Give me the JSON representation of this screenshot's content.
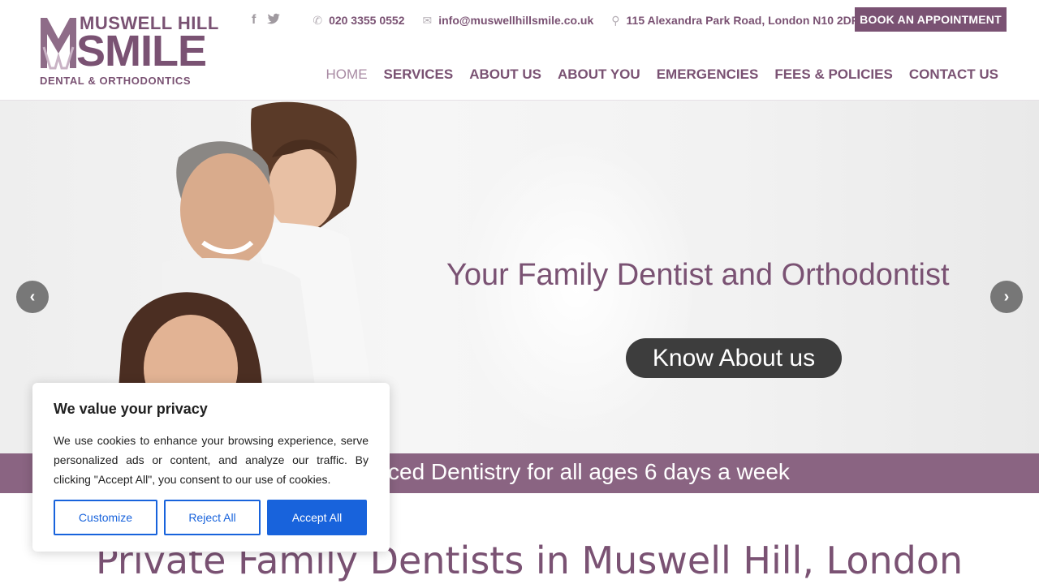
{
  "logo": {
    "line1": "MUSWELL HILL",
    "line2": "SMILE",
    "line3": "DENTAL & ORTHODONTICS"
  },
  "topbar": {
    "phone": "020 3355 0552",
    "email": "info@muswellhillsmile.co.uk",
    "address": "115 Alexandra Park Road, London N10 2DP",
    "book_label": "BOOK AN APPOINTMENT"
  },
  "nav": {
    "items": [
      "HOME",
      "SERVICES",
      "ABOUT US",
      "ABOUT YOU",
      "EMERGENCIES",
      "FEES & POLICIES",
      "CONTACT US"
    ]
  },
  "hero": {
    "title": "Your Family Dentist and Orthodontist",
    "cta": "Know About us",
    "ribbon": "ced Dentistry for all ages 6 days a week"
  },
  "main": {
    "heading": "Private Family Dentists in Muswell Hill, London"
  },
  "cookie": {
    "title": "We value your privacy",
    "text": "We use cookies to enhance your browsing experience, serve personalized ads or content, and analyze our traffic. By clicking \"Accept All\", you consent to our use of cookies.",
    "customize": "Customize",
    "reject": "Reject All",
    "accept": "Accept All"
  },
  "colors": {
    "brand": "#7a5273",
    "ribbon": "#8a6482",
    "accept_blue": "#1863dc"
  }
}
